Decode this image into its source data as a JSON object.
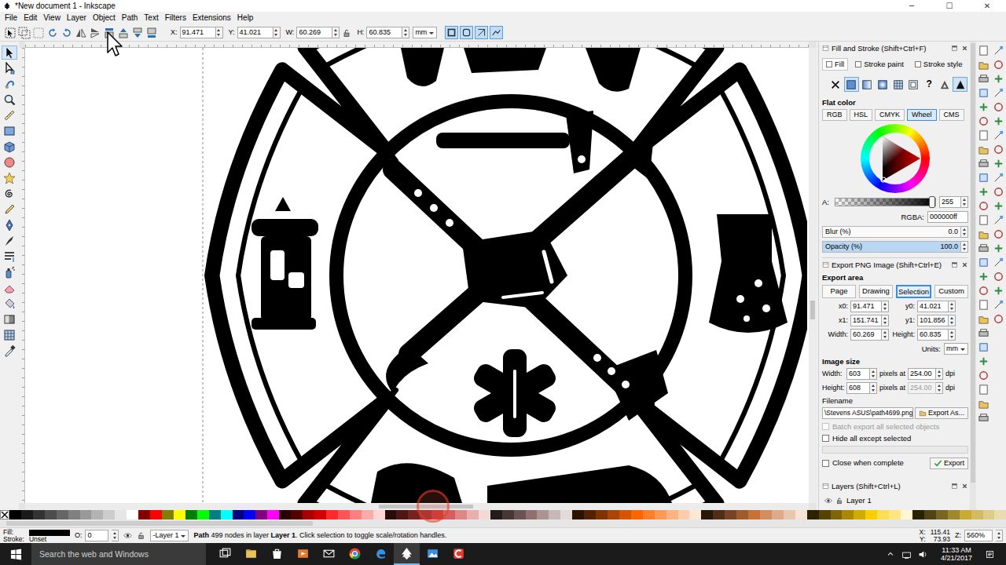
{
  "window": {
    "title": "*New document 1 - Inkscape",
    "controls": [
      "─",
      "☐",
      "✕"
    ]
  },
  "menu": [
    "File",
    "Edit",
    "View",
    "Layer",
    "Object",
    "Path",
    "Text",
    "Filters",
    "Extensions",
    "Help"
  ],
  "tool_controls": {
    "fields": [
      {
        "label": "X:",
        "value": "91.471"
      },
      {
        "label": "Y:",
        "value": "41.021"
      },
      {
        "label": "W:",
        "value": "60.269"
      },
      {
        "label": "H:",
        "value": "60.835"
      }
    ],
    "unit": "mm",
    "toggles": [
      {
        "selected": true
      },
      {
        "selected": true
      },
      {
        "selected": true
      },
      {
        "selected": true
      }
    ]
  },
  "tools": [
    {
      "kind": "selector",
      "selected": true
    },
    {
      "kind": "node",
      "selected": false
    },
    {
      "kind": "tweak",
      "selected": false
    },
    {
      "kind": "zoom",
      "selected": false
    },
    {
      "kind": "measure",
      "selected": false
    },
    {
      "kind": "rect",
      "selected": false
    },
    {
      "kind": "box3d",
      "selected": false
    },
    {
      "kind": "ellipse",
      "selected": false
    },
    {
      "kind": "star",
      "selected": false
    },
    {
      "kind": "spiral",
      "selected": false
    },
    {
      "kind": "pencil",
      "selected": false
    },
    {
      "kind": "pen",
      "selected": false
    },
    {
      "kind": "calligraphy",
      "selected": false
    },
    {
      "kind": "text",
      "selected": false
    },
    {
      "kind": "spray",
      "selected": false
    },
    {
      "kind": "eraser",
      "selected": false
    },
    {
      "kind": "bucket",
      "selected": false
    },
    {
      "kind": "gradient",
      "selected": false
    },
    {
      "kind": "mesh",
      "selected": false
    },
    {
      "kind": "dropper",
      "selected": false
    }
  ],
  "fill_stroke": {
    "title": "Fill and Stroke (Shift+Ctrl+F)",
    "tabs": [
      {
        "label": "Fill",
        "selected": true
      },
      {
        "label": "Stroke paint",
        "selected": false
      },
      {
        "label": "Stroke style",
        "selected": false
      }
    ],
    "paint_types": [
      {
        "kind": "none",
        "selected": false
      },
      {
        "kind": "flat",
        "selected": true
      },
      {
        "kind": "linear",
        "selected": false
      },
      {
        "kind": "radial",
        "selected": false
      },
      {
        "kind": "mesh",
        "selected": false
      },
      {
        "kind": "pattern",
        "selected": false
      },
      {
        "kind": "unknown",
        "label": "?",
        "selected": false
      },
      {
        "kind": "evenodd",
        "selected": false
      },
      {
        "kind": "nonzero",
        "selected": true
      }
    ],
    "mode": "Flat color",
    "color_tabs": [
      {
        "label": "RGB",
        "selected": false
      },
      {
        "label": "HSL",
        "selected": false
      },
      {
        "label": "CMYK",
        "selected": false
      },
      {
        "label": "Wheel",
        "selected": true
      },
      {
        "label": "CMS",
        "selected": false
      }
    ],
    "alpha": {
      "label": "A:",
      "value": "255",
      "level": 1
    },
    "rgba": {
      "label": "RGBA:",
      "value": "000000ff"
    },
    "blur": {
      "label": "Blur (%)",
      "value": "0.0",
      "level": 0
    },
    "opacity": {
      "label": "Opacity (%)",
      "value": "100.0",
      "level": 1
    }
  },
  "export": {
    "title": "Export PNG Image (Shift+Ctrl+E)",
    "area_label": "Export area",
    "area_buttons": [
      {
        "label": "Page",
        "selected": false
      },
      {
        "label": "Drawing",
        "selected": false
      },
      {
        "label": "Selection",
        "selected": true
      },
      {
        "label": "Custom",
        "selected": false
      }
    ],
    "coords": [
      {
        "label": "x0:",
        "value": "91.471"
      },
      {
        "label": "y0:",
        "value": "41.021"
      },
      {
        "label": "x1:",
        "value": "151.741"
      },
      {
        "label": "y1:",
        "value": "101.856"
      },
      {
        "label": "Width:",
        "value": "60.269"
      },
      {
        "label": "Height:",
        "value": "60.835"
      }
    ],
    "units_label": "Units:",
    "units": "mm",
    "size_label": "Image size",
    "size_rows": [
      {
        "label": "Width:",
        "value": "603",
        "mid": "pixels at",
        "dpi": "254.00",
        "unit": "dpi",
        "dpi_disabled": false
      },
      {
        "label": "Height:",
        "value": "608",
        "mid": "pixels at",
        "dpi": "254.00",
        "unit": "dpi",
        "dpi_disabled": true
      }
    ],
    "filename_label": "Filename",
    "filename": "\\Stevens ASUS\\path4699.png",
    "export_as": "Export As...",
    "options": [
      {
        "label": "Batch export all selected objects",
        "checked": false,
        "disabled": true
      },
      {
        "label": "Hide all except selected",
        "checked": false,
        "disabled": false
      }
    ],
    "close_option": {
      "label": "Close when complete",
      "checked": false
    },
    "export_button": "Export"
  },
  "layers": {
    "title": "Layers (Shift+Ctrl+L)",
    "items": [
      {
        "name": "Layer 1",
        "visible": true,
        "locked": false
      }
    ]
  },
  "palette": [
    {
      "color": "#000000"
    },
    {
      "color": "#1a1a1a"
    },
    {
      "color": "#333333"
    },
    {
      "color": "#4d4d4d"
    },
    {
      "color": "#666666"
    },
    {
      "color": "#808080"
    },
    {
      "color": "#999999"
    },
    {
      "color": "#b3b3b3"
    },
    {
      "color": "#cccccc"
    },
    {
      "color": "#e6e6e6"
    },
    {
      "color": "#ffffff"
    },
    {
      "color": "#800000"
    },
    {
      "color": "#ff0000"
    },
    {
      "color": "#808000"
    },
    {
      "color": "#ffff00"
    },
    {
      "color": "#008000"
    },
    {
      "color": "#00ff00"
    },
    {
      "color": "#008080"
    },
    {
      "color": "#00ffff"
    },
    {
      "color": "#000080"
    },
    {
      "color": "#0000ff"
    },
    {
      "color": "#800080"
    },
    {
      "color": "#ff00ff"
    },
    {
      "color": "#2b0000"
    },
    {
      "color": "#550000"
    },
    {
      "color": "#aa0000"
    },
    {
      "color": "#d40000"
    },
    {
      "color": "#ff2a2a"
    },
    {
      "color": "#ff5555"
    },
    {
      "color": "#ff8080"
    },
    {
      "color": "#ffaaaa"
    },
    {
      "color": "#ffd5d5"
    },
    {
      "color": "#280b0b"
    },
    {
      "color": "#501616"
    },
    {
      "color": "#782121"
    },
    {
      "color": "#a02c2c"
    },
    {
      "color": "#c83737"
    },
    {
      "color": "#d35f5f"
    },
    {
      "color": "#de8787"
    },
    {
      "color": "#e9afaf"
    },
    {
      "color": "#f4d7d7"
    },
    {
      "color": "#241c1c"
    },
    {
      "color": "#483737"
    },
    {
      "color": "#6c5353"
    },
    {
      "color": "#916f6f"
    },
    {
      "color": "#ac9393"
    },
    {
      "color": "#c8b7b7"
    },
    {
      "color": "#e3dbdb"
    },
    {
      "color": "#2b1100"
    },
    {
      "color": "#552200"
    },
    {
      "color": "#803300"
    },
    {
      "color": "#aa4400"
    },
    {
      "color": "#d45500"
    },
    {
      "color": "#ff6600"
    },
    {
      "color": "#ff7f2a"
    },
    {
      "color": "#ff9955"
    },
    {
      "color": "#ffb380"
    },
    {
      "color": "#ffccaa"
    },
    {
      "color": "#ffe6d5"
    },
    {
      "color": "#28170b"
    },
    {
      "color": "#502d16"
    },
    {
      "color": "#784421"
    },
    {
      "color": "#a05a2c"
    },
    {
      "color": "#c87137"
    },
    {
      "color": "#d38d5f"
    },
    {
      "color": "#deaa87"
    },
    {
      "color": "#e9c6af"
    },
    {
      "color": "#f4e3d7"
    },
    {
      "color": "#2b2200"
    },
    {
      "color": "#554400"
    },
    {
      "color": "#806600"
    },
    {
      "color": "#aa8800"
    },
    {
      "color": "#d4aa00"
    },
    {
      "color": "#ffcc00"
    },
    {
      "color": "#ffdd55"
    },
    {
      "color": "#ffe680"
    },
    {
      "color": "#fff6d5"
    },
    {
      "color": "#282200"
    },
    {
      "color": "#504416"
    },
    {
      "color": "#786721"
    },
    {
      "color": "#a0892c"
    },
    {
      "color": "#c8ab37"
    },
    {
      "color": "#d3bc5f"
    },
    {
      "color": "#decd87"
    },
    {
      "color": "#e9ddaf"
    }
  ],
  "status_bar": {
    "fill_label": "Fill:",
    "stroke_label": "Stroke:",
    "stroke_value": "Unset",
    "opacity_label": "O:",
    "opacity_value": "0",
    "layer": "-Layer 1",
    "message": [
      {
        "text": "Path",
        "bold": true
      },
      {
        "text": " 499 nodes in layer ",
        "bold": false
      },
      {
        "text": "Layer 1",
        "bold": true
      },
      {
        "text": ". Click selection to toggle scale/rotation handles.",
        "bold": false
      }
    ],
    "x_label": "X:",
    "x": "115.41",
    "y_label": "Y:",
    "y": "73.93",
    "zoom_label": "Z:",
    "zoom": "560%"
  },
  "taskbar": {
    "search_placeholder": "Search the web and Windows",
    "apps": [
      {
        "kind": "task-view",
        "active": false
      },
      {
        "kind": "file-explorer",
        "active": false
      },
      {
        "kind": "store",
        "active": false
      },
      {
        "kind": "media",
        "active": false
      },
      {
        "kind": "mail",
        "active": false
      },
      {
        "kind": "chrome",
        "active": false
      },
      {
        "kind": "edge",
        "active": false
      },
      {
        "kind": "inkscape",
        "active": true
      },
      {
        "kind": "photos",
        "active": false
      },
      {
        "kind": "red-app",
        "active": false
      }
    ],
    "time": "11:33 AM",
    "date": "4/21/2017"
  }
}
